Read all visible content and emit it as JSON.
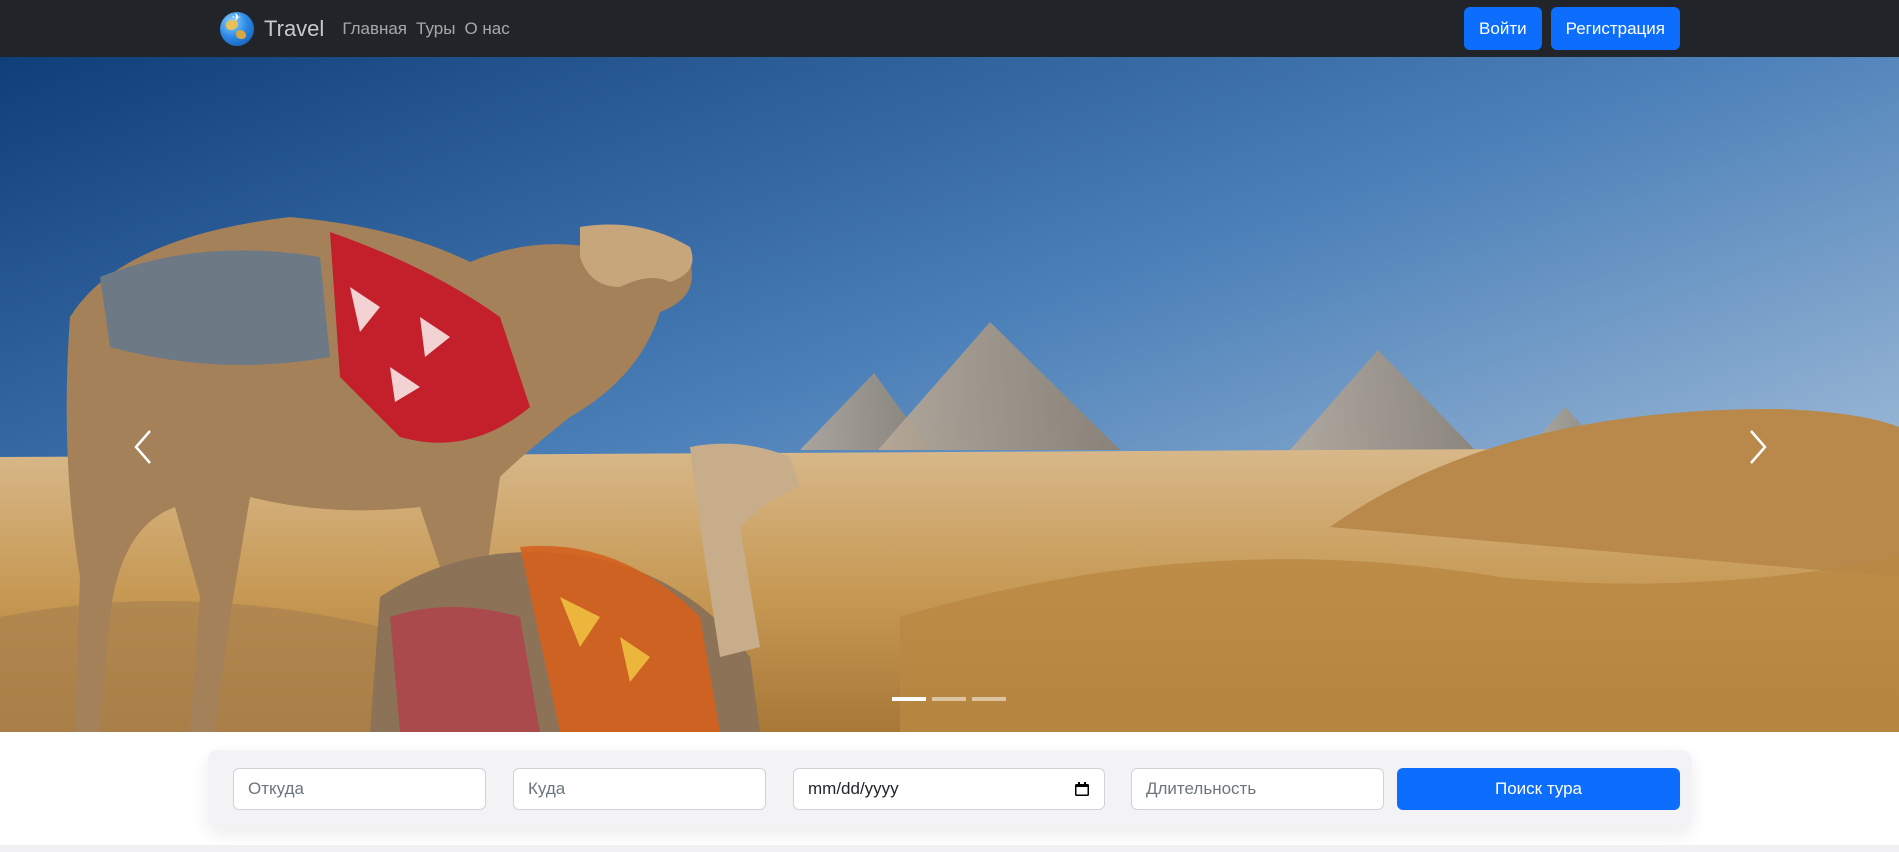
{
  "navbar": {
    "brand": "Travel",
    "links": [
      "Главная",
      "Туры",
      "О нас"
    ],
    "login_label": "Войти",
    "register_label": "Регистрация"
  },
  "carousel": {
    "slide_count": 3,
    "active_slide": 1,
    "slide_subject": "camels in front of the Giza pyramids"
  },
  "search": {
    "from_placeholder": "Откуда",
    "to_placeholder": "Куда",
    "date_value": "mm/dd/yyyy",
    "duration_placeholder": "Длительность",
    "submit_label": "Поиск тура"
  },
  "colors": {
    "navbar_bg": "#212529",
    "accent": "#0d6efd"
  },
  "icons": [
    "globe-logo-icon",
    "chevron-left-icon",
    "chevron-right-icon",
    "calendar-icon"
  ]
}
